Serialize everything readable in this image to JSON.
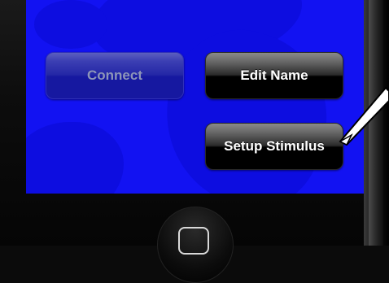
{
  "buttons": {
    "connect": {
      "label": "Connect",
      "enabled": false
    },
    "edit_name": {
      "label": "Edit Name",
      "enabled": true
    },
    "setup_stimulus": {
      "label": "Setup Stimulus",
      "enabled": true
    }
  },
  "colors": {
    "screen_background": "#1212f2",
    "button_text": "#ffffff",
    "disabled_text": "#8e96b8",
    "callout_arrow": "#ffffff"
  },
  "icons": {
    "home": "home-button-icon",
    "callout": "callout-arrow-icon"
  }
}
